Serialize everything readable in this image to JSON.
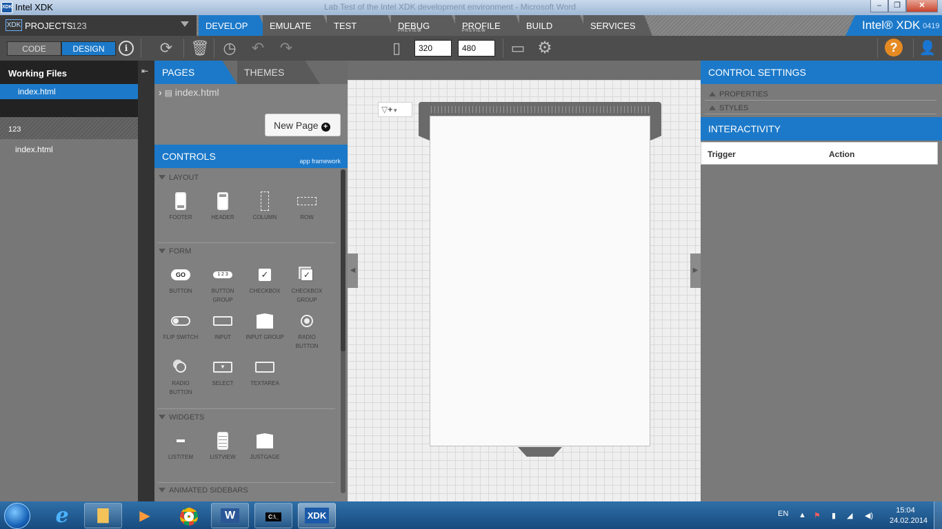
{
  "window": {
    "title": "Intel XDK",
    "app_icon_text": "XDK",
    "background_title": "Lab Test of the Intel XDK development environment - Microsoft Word",
    "minimize": "–",
    "maximize": "❐",
    "close": "✕"
  },
  "project": {
    "logo": "XDK",
    "label": "PROJECTS",
    "name": "123"
  },
  "tabs": [
    {
      "label": "DEVELOP",
      "sub": "",
      "active": true
    },
    {
      "label": "EMULATE",
      "sub": ""
    },
    {
      "label": "TEST",
      "sub": ""
    },
    {
      "label": "DEBUG",
      "sub": "PREVIEW"
    },
    {
      "label": "PROFILE",
      "sub": "PREVIEW"
    },
    {
      "label": "BUILD",
      "sub": ""
    },
    {
      "label": "SERVICES",
      "sub": ""
    }
  ],
  "brand": {
    "name": "Intel® XDK",
    "version": "0419"
  },
  "toolbar": {
    "code_label": "CODE",
    "design_label": "DESIGN",
    "width_value": "320",
    "height_value": "480"
  },
  "working_files": {
    "title": "Working Files",
    "active_file": "index.html",
    "project_name": "123",
    "project_file": "index.html"
  },
  "pages_panel": {
    "tab_pages": "PAGES",
    "tab_themes": "THEMES",
    "page_file": "index.html",
    "new_page": "New Page"
  },
  "controls": {
    "title": "CONTROLS",
    "framework": "app framework",
    "sections": {
      "layout": "LAYOUT",
      "form": "FORM",
      "widgets": "WIDGETS",
      "animated": "ANIMATED SIDEBARS"
    },
    "layout_items": [
      "FOOTER",
      "HEADER",
      "COLUMN",
      "ROW"
    ],
    "form_items": [
      "BUTTON",
      "BUTTON GROUP",
      "CHECKBOX",
      "CHECKBOX GROUP",
      "FLIP SWITCH",
      "INPUT",
      "INPUT GROUP",
      "RADIO BUTTON",
      "RADIO BUTTON",
      "SELECT",
      "TEXTAREA"
    ],
    "widget_items": [
      "LISTITEM",
      "LISTVIEW",
      "JUSTGAGE"
    ],
    "button_icon_text": "GO",
    "button_group_icon_text": "1 2 3"
  },
  "control_settings": {
    "title": "CONTROL SETTINGS",
    "properties": "PROPERTIES",
    "styles": "STYLES"
  },
  "interactivity": {
    "title": "INTERACTIVITY",
    "trigger": "Trigger",
    "action": "Action"
  },
  "taskbar": {
    "lang": "EN",
    "time": "15:04",
    "date": "24.02.2014",
    "apps": [
      "explorer",
      "media-player",
      "chrome",
      "word",
      "cmd",
      "xdk"
    ],
    "word_label": "W",
    "cmd_label": "C:\\_",
    "xdk_label": "XDK"
  },
  "colors": {
    "accent": "#1c79c9",
    "toolbar": "#4d4d4d",
    "help": "#e58a23"
  }
}
